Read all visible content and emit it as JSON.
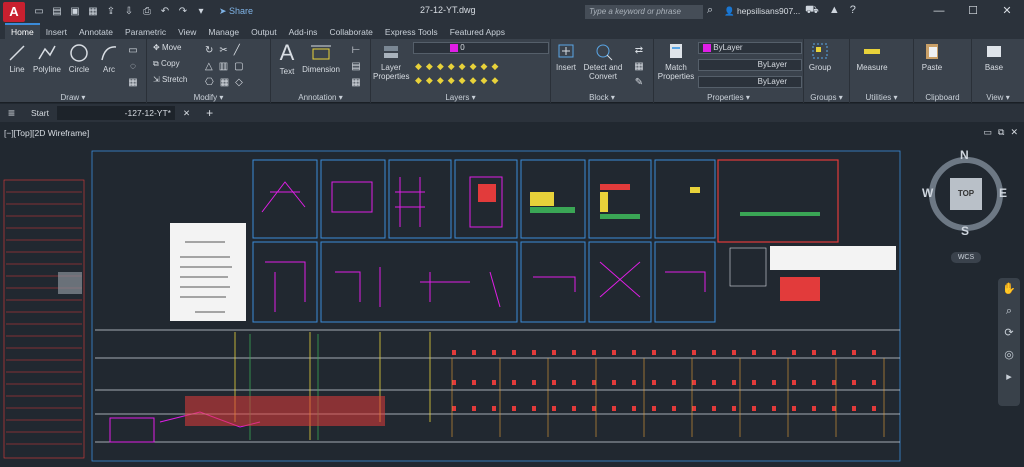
{
  "app": {
    "logo": "A",
    "title": "27-12-YT.dwg",
    "share_label": "Share"
  },
  "search": {
    "placeholder": "Type a keyword or phrase"
  },
  "user": {
    "name": "hepsilisans907..."
  },
  "tabs": [
    "Home",
    "Insert",
    "Annotate",
    "Parametric",
    "View",
    "Manage",
    "Output",
    "Add-ins",
    "Collaborate",
    "Express Tools",
    "Featured Apps"
  ],
  "active_tab": "Home",
  "ribbon": {
    "draw": {
      "label": "Draw",
      "line": "Line",
      "polyline": "Polyline",
      "circle": "Circle",
      "arc": "Arc"
    },
    "modify": {
      "label": "Modify",
      "move": "Move",
      "copy": "Copy",
      "stretch": "Stretch"
    },
    "annotation": {
      "label": "Annotation",
      "text": "Text",
      "dimension": "Dimension"
    },
    "layers": {
      "label": "Layers",
      "layer_properties": "Layer Properties",
      "current_layer": "0"
    },
    "block": {
      "label": "Block",
      "insert": "Insert",
      "detect": "Detect and Convert"
    },
    "properties": {
      "label": "Properties",
      "match": "Match Properties",
      "color": "ByLayer",
      "linetype": "ByLayer",
      "lineweight": "ByLayer"
    },
    "groups": {
      "label": "Groups",
      "group": "Group"
    },
    "utilities": {
      "label": "Utilities",
      "measure": "Measure"
    },
    "clipboard": {
      "label": "Clipboard",
      "paste": "Paste"
    },
    "view": {
      "label": "View",
      "base": "Base"
    }
  },
  "doc_tabs": {
    "start": "Start",
    "current": "-127-12-YT*"
  },
  "viewport": {
    "label": "[−][Top][2D Wireframe]"
  },
  "viewcube": {
    "n": "N",
    "s": "S",
    "e": "E",
    "w": "W",
    "top": "TOP",
    "wcs": "WCS"
  },
  "colors": {
    "accent": "#3b8bd9",
    "magenta": "#e01ee6",
    "red": "#e23b3b",
    "yellow": "#e8d23a"
  }
}
